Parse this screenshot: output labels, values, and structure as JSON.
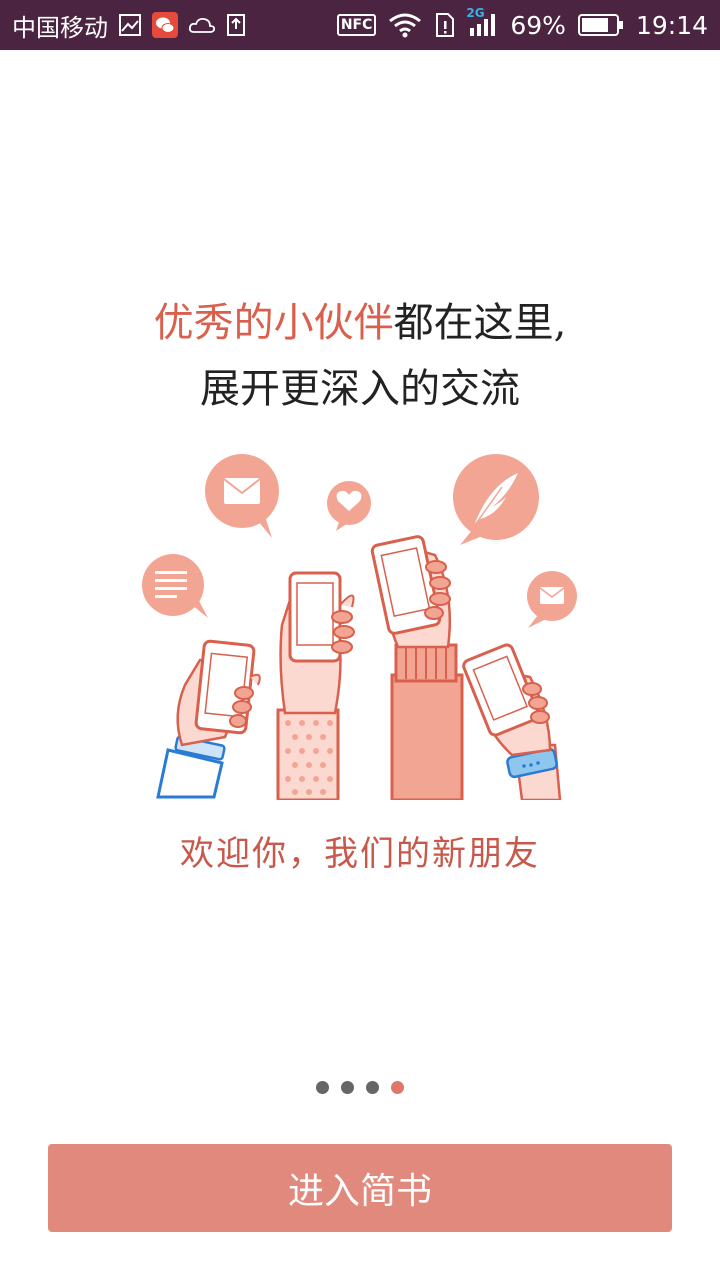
{
  "status_bar": {
    "carrier": "中国移动",
    "nfc": "NFC",
    "network": "2G",
    "battery": "69%",
    "time": "19:14",
    "icons": [
      "gallery-icon",
      "wechat-icon",
      "weather-cloud-icon",
      "upload-icon",
      "nfc-icon",
      "wifi-icon",
      "sim-alert-icon",
      "signal-icon",
      "battery-icon"
    ]
  },
  "headline": {
    "line1_accent": "优秀的小伙伴",
    "line1_rest": "都在这里,",
    "line2": "展开更深入的交流"
  },
  "welcome_text": "欢迎你，我们的新朋友",
  "pager": {
    "count": 4,
    "active_index": 3
  },
  "enter_button": {
    "label": "进入简书"
  },
  "colors": {
    "accent": "#d9604c",
    "button": "#e0897c",
    "statusbar": "#4a2440"
  }
}
